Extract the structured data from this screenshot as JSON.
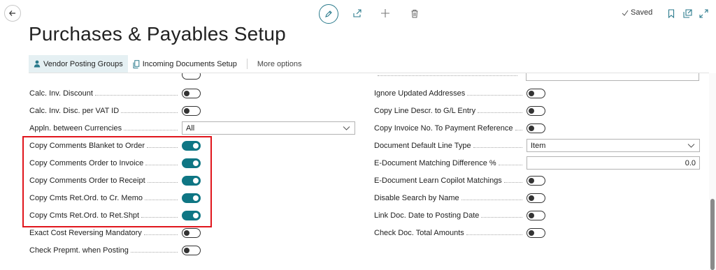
{
  "topbar": {
    "status": "Saved",
    "icons": [
      "back-arrow-icon",
      "pencil-icon",
      "share-icon",
      "plus-icon",
      "trash-icon",
      "check-icon",
      "bookmark-icon",
      "open-new-window-icon",
      "expand-icon"
    ]
  },
  "page": {
    "title": "Purchases & Payables Setup"
  },
  "actions": {
    "vendor_posting_groups": "Vendor Posting Groups",
    "incoming_documents_setup": "Incoming Documents Setup",
    "more_options": "More options"
  },
  "left": {
    "rows": [
      {
        "label": "Calc. Inv. Discount",
        "type": "toggle",
        "value": false
      },
      {
        "label": "Calc. Inv. Disc. per VAT ID",
        "type": "toggle",
        "value": false
      },
      {
        "label": "Appln. between Currencies",
        "type": "select",
        "value": "All"
      },
      {
        "label": "Copy Comments Blanket to Order",
        "type": "toggle",
        "value": true
      },
      {
        "label": "Copy Comments Order to Invoice",
        "type": "toggle",
        "value": true
      },
      {
        "label": "Copy Comments Order to Receipt",
        "type": "toggle",
        "value": true
      },
      {
        "label": "Copy Cmts Ret.Ord. to Cr. Memo",
        "type": "toggle",
        "value": true
      },
      {
        "label": "Copy Cmts Ret.Ord. to Ret.Shpt",
        "type": "toggle",
        "value": true
      },
      {
        "label": "Exact Cost Reversing Mandatory",
        "type": "toggle",
        "value": false
      },
      {
        "label": "Check Prepmt. when Posting",
        "type": "toggle",
        "value": false
      }
    ]
  },
  "right": {
    "rows": [
      {
        "label": "Ignore Updated Addresses",
        "type": "toggle",
        "value": false
      },
      {
        "label": "Copy Line Descr. to G/L Entry",
        "type": "toggle",
        "value": false
      },
      {
        "label": "Copy Invoice No. To Payment Reference",
        "type": "toggle",
        "value": false
      },
      {
        "label": "Document Default Line Type",
        "type": "select",
        "value": "Item"
      },
      {
        "label": "E-Document Matching Difference %",
        "type": "input",
        "value": "0.0"
      },
      {
        "label": "E-Document Learn Copilot Matchings",
        "type": "toggle",
        "value": false
      },
      {
        "label": "Disable Search by Name",
        "type": "toggle",
        "value": false
      },
      {
        "label": "Link Doc. Date to Posting Date",
        "type": "toggle",
        "value": false
      },
      {
        "label": "Check Doc. Total Amounts",
        "type": "toggle",
        "value": false
      }
    ]
  },
  "colors": {
    "accent": "#0f7684",
    "highlight_border": "#e0151c"
  }
}
